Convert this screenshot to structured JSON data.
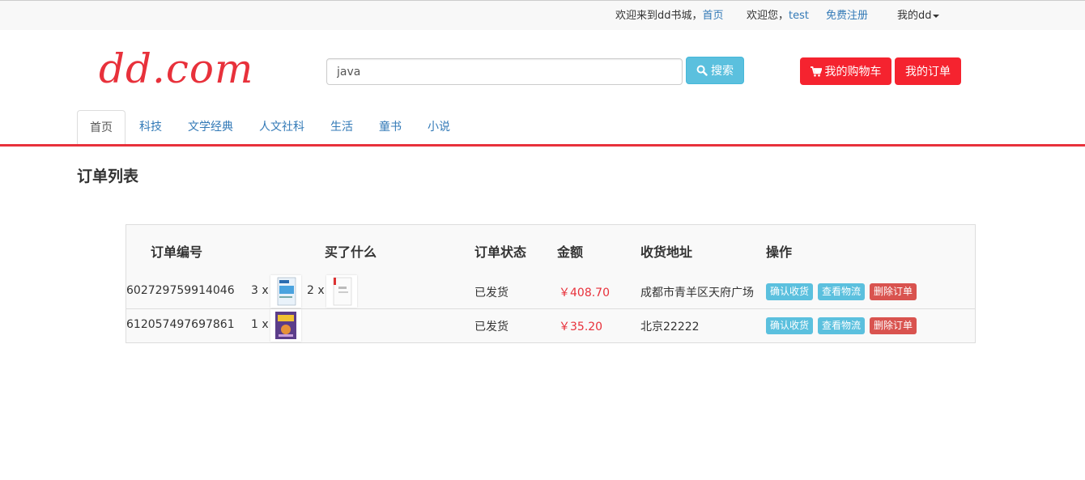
{
  "topbar": {
    "welcome_text": "欢迎来到dd书城，",
    "home_link": "首页",
    "greeting": "欢迎您，",
    "username": "test",
    "register_link": "免费注册",
    "my_dd": "我的dd"
  },
  "header": {
    "logo": "dd.com",
    "search_value": "java",
    "search_button": "搜索",
    "cart_button": "我的购物车",
    "orders_button": "我的订单"
  },
  "nav": {
    "tabs": [
      {
        "label": "首页",
        "active": true
      },
      {
        "label": "科技",
        "active": false
      },
      {
        "label": "文学经典",
        "active": false
      },
      {
        "label": "人文社科",
        "active": false
      },
      {
        "label": "生活",
        "active": false
      },
      {
        "label": "童书",
        "active": false
      },
      {
        "label": "小说",
        "active": false
      }
    ]
  },
  "page": {
    "title": "订单列表"
  },
  "table": {
    "headers": [
      "订单编号",
      "买了什么",
      "订单状态",
      "金额",
      "收货地址",
      "操作"
    ],
    "actions": {
      "confirm": "确认收货",
      "logistics": "查看物流",
      "delete": "删除订单"
    },
    "rows": [
      {
        "order_id": "602729759914046",
        "items": [
          {
            "qty": "3 x"
          },
          {
            "qty": "2 x"
          }
        ],
        "status": "已发货",
        "amount": "￥408.70",
        "address": "成都市青羊区天府广场"
      },
      {
        "order_id": "612057497697861",
        "items": [
          {
            "qty": "1 x"
          }
        ],
        "status": "已发货",
        "amount": "￥35.20",
        "address": "北京22222"
      }
    ]
  },
  "colors": {
    "brand_red": "#e8313b",
    "button_red": "#f5232f",
    "info": "#5bc0de",
    "danger": "#d9534f",
    "link": "#337ab7"
  }
}
